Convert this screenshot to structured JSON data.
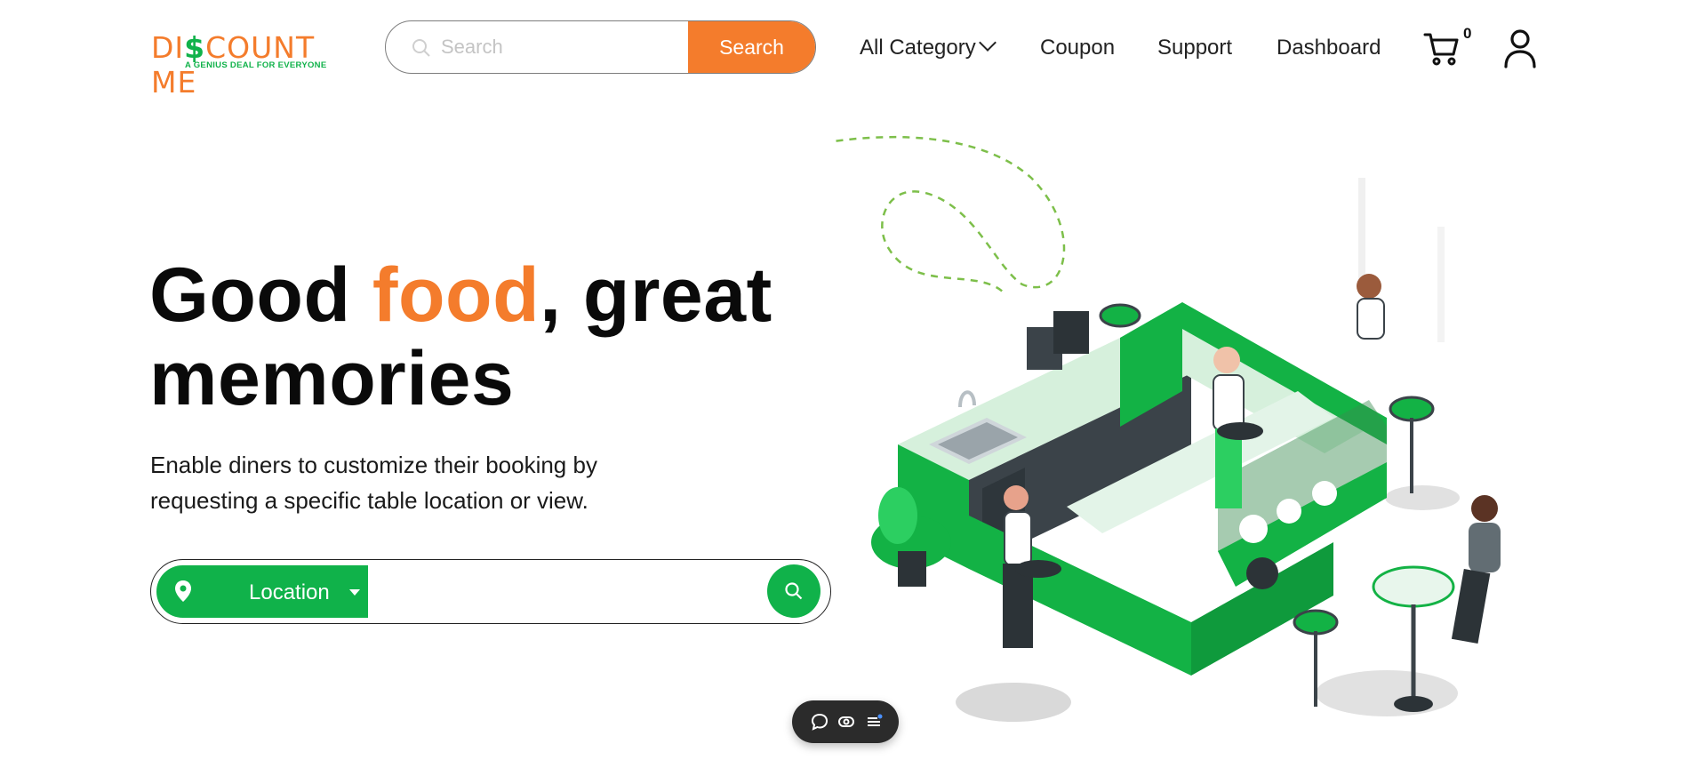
{
  "brand": {
    "name_prefix": "DI",
    "name_symbol": "$",
    "name_suffix": "COUNT ME",
    "tagline": "A GENIUS DEAL FOR EVERYONE"
  },
  "search": {
    "placeholder": "Search",
    "button_label": "Search"
  },
  "nav": {
    "category": "All Category",
    "coupon": "Coupon",
    "support": "Support",
    "dashboard": "Dashboard"
  },
  "cart": {
    "count": "0"
  },
  "hero": {
    "title_part1": "Good ",
    "title_accent": "food",
    "title_part2": ", great",
    "title_line2": "memories",
    "description_line1": "Enable diners to customize their booking by",
    "description_line2": "requesting a specific table location or view."
  },
  "location": {
    "label": "Location",
    "input_value": ""
  },
  "colors": {
    "accent_orange": "#F47C2C",
    "brand_green": "#10B24A"
  }
}
